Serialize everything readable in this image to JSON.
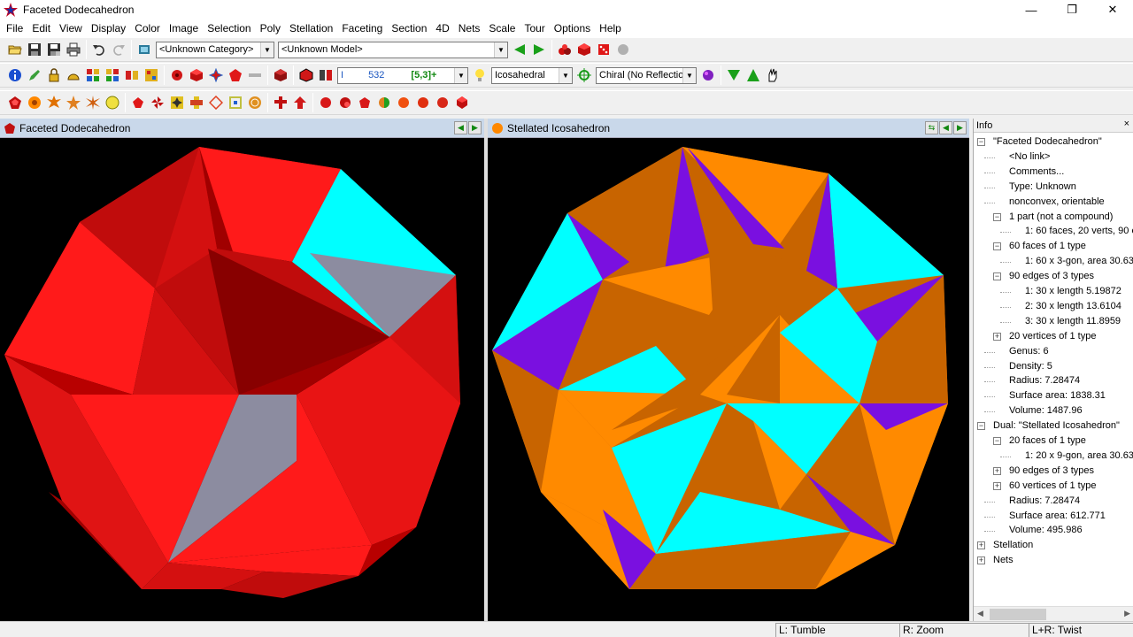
{
  "window": {
    "title": "Faceted Dodecahedron",
    "minimize": "—",
    "restore": "❐",
    "close": "✕"
  },
  "menu": [
    "File",
    "Edit",
    "View",
    "Display",
    "Color",
    "Image",
    "Selection",
    "Poly",
    "Stellation",
    "Faceting",
    "Section",
    "4D",
    "Nets",
    "Scale",
    "Tour",
    "Options",
    "Help"
  ],
  "toolbar1": {
    "category_value": "<Unknown Category>",
    "model_value": "<Unknown Model>"
  },
  "toolbar2": {
    "poly_index_prefix": "I",
    "poly_index_value": "532",
    "symmetry_code": "[5,3]+",
    "symmetry_group": "Icosahedral",
    "reflection_mode": "Chiral (No Reflection)"
  },
  "left_pane": {
    "title": "Faceted Dodecahedron"
  },
  "right_pane": {
    "title": "Stellated Icosahedron"
  },
  "info": {
    "title": "Info",
    "close": "×",
    "items": [
      {
        "text": "\"Faceted Dodecahedron\"",
        "expander": "−"
      },
      {
        "text": "<No link>"
      },
      {
        "text": "Comments..."
      },
      {
        "text": "Type: Unknown"
      },
      {
        "text": "nonconvex, orientable"
      },
      {
        "text": "1 part (not a compound)",
        "expander": "−"
      },
      {
        "text": "1: 60 faces, 20 verts, 90 e"
      },
      {
        "text": "60 faces of 1 type",
        "expander": "−"
      },
      {
        "text": "1: 60 x 3-gon, area 30.63"
      },
      {
        "text": "90 edges of 3 types",
        "expander": "−"
      },
      {
        "text": "1: 30 x length 5.19872"
      },
      {
        "text": "2: 30 x length 13.6104"
      },
      {
        "text": "3: 30 x length 11.8959"
      },
      {
        "text": "20 vertices of 1 type",
        "expander": "+"
      },
      {
        "text": "Genus: 6"
      },
      {
        "text": "Density: 5"
      },
      {
        "text": "Radius: 7.28474"
      },
      {
        "text": "Surface area: 1838.31"
      },
      {
        "text": "Volume: 1487.96"
      },
      {
        "text": "Dual: \"Stellated Icosahedron\"",
        "expander": "−"
      },
      {
        "text": "20 faces of 1 type",
        "expander": "−"
      },
      {
        "text": "1: 20 x 9-gon, area 30.63"
      },
      {
        "text": "90 edges of 3 types",
        "expander": "+"
      },
      {
        "text": "60 vertices of 1 type",
        "expander": "+"
      },
      {
        "text": "Radius: 7.28474"
      },
      {
        "text": "Surface area: 612.771"
      },
      {
        "text": "Volume: 495.986"
      },
      {
        "text": "Stellation",
        "expander": "+"
      },
      {
        "text": "Nets",
        "expander": "+"
      }
    ]
  },
  "status": {
    "left": "L: Tumble",
    "right": "R: Zoom",
    "both": "L+R: Twist"
  },
  "colors": {
    "red": "#ff1a1a",
    "dark_red": "#b80000",
    "cyan": "#00ffff",
    "gray": "#8c8ca0",
    "orange": "#ff8a00",
    "brown": "#c86400",
    "purple": "#7a10e0"
  }
}
